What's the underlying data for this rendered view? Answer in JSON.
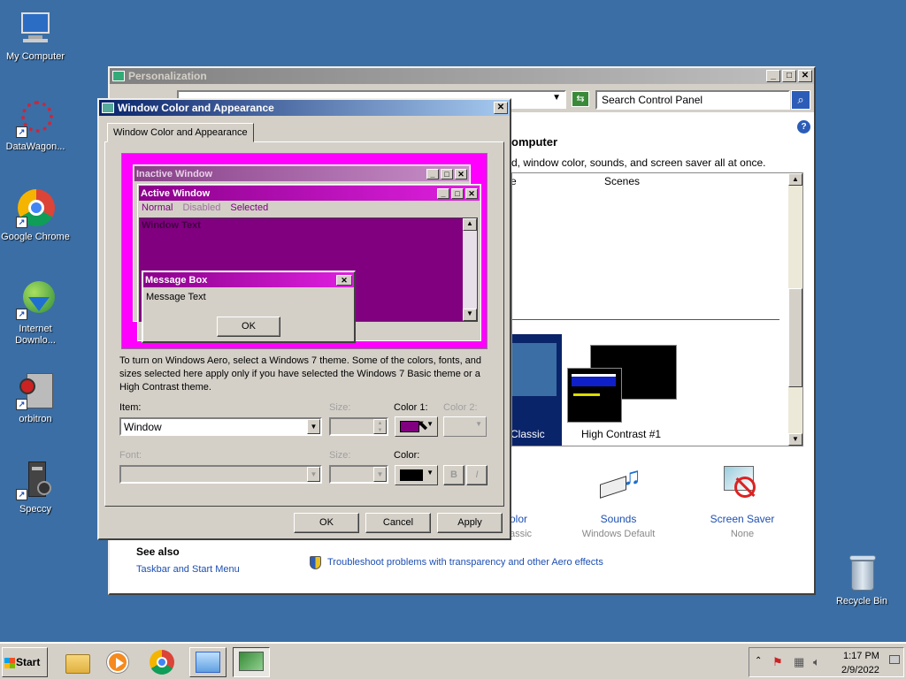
{
  "desktop": {
    "icons": [
      {
        "label": "My Computer"
      },
      {
        "label": "DataWagon..."
      },
      {
        "label": "Google Chrome"
      },
      {
        "label": "Internet Downlo..."
      },
      {
        "label": "orbitron"
      },
      {
        "label": "Speccy"
      },
      {
        "label": "Recycle Bin"
      }
    ]
  },
  "personalization": {
    "title": "Personalization",
    "search_placeholder": "Search Control Panel",
    "heading_fragment": "omputer",
    "description_fragment": "d, window color, sounds, and screen saver all at once.",
    "col_fragment": "e",
    "scenes_label": "Scenes",
    "classic_label": "Classic",
    "high_contrast_label": "High Contrast #1",
    "color_fragment": "olor",
    "classic_sub": "assic",
    "sounds_label": "Sounds",
    "sounds_sub": "Windows Default",
    "screensaver_label": "Screen Saver",
    "screensaver_sub": "None",
    "see_also": "See also",
    "taskbar_link": "Taskbar and Start Menu",
    "troubleshoot_link": "Troubleshoot problems with transparency and other Aero effects"
  },
  "dialog": {
    "title": "Window Color and Appearance",
    "tab": "Window Color and Appearance",
    "preview": {
      "inactive": "Inactive Window",
      "active": "Active Window",
      "menu_normal": "Normal",
      "menu_disabled": "Disabled",
      "menu_selected": "Selected",
      "window_text": "Window Text",
      "msgbox_title": "Message Box",
      "msgbox_text": "Message Text",
      "msgbox_ok": "OK"
    },
    "info_text": "To turn on Windows Aero, select a Windows 7 theme.  Some of the colors, fonts, and sizes selected here apply only if you have selected the Windows 7 Basic theme or a High Contrast theme.",
    "item_label": "Item:",
    "item_value": "Window",
    "size_label": "Size:",
    "color1_label": "Color 1:",
    "color2_label": "Color 2:",
    "font_label": "Font:",
    "size2_label": "Size:",
    "color_label": "Color:",
    "bold_label": "B",
    "italic_label": "I",
    "ok": "OK",
    "cancel": "Cancel",
    "apply": "Apply",
    "colors": {
      "window": "#800080",
      "font": "#000000"
    }
  },
  "taskbar": {
    "start": "Start",
    "time": "1:17 PM",
    "date": "2/9/2022"
  }
}
